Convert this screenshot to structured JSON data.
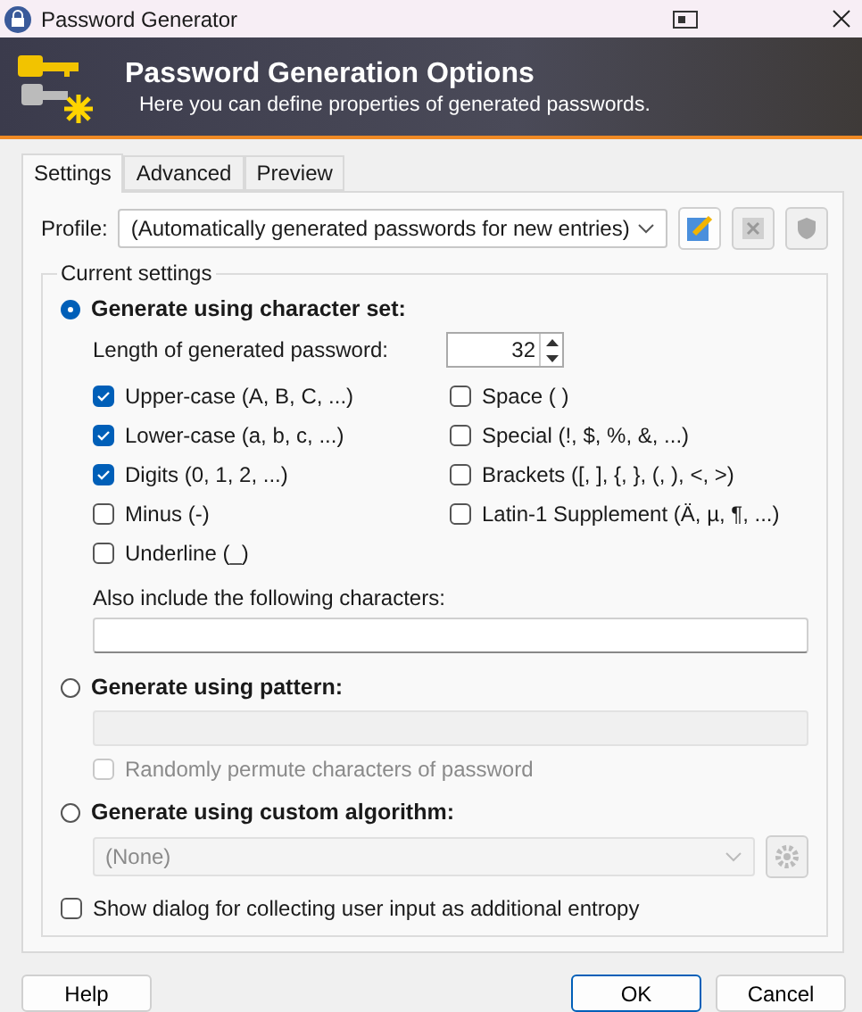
{
  "window": {
    "title": "Password Generator"
  },
  "banner": {
    "title": "Password Generation Options",
    "subtitle": "Here you can define properties of generated passwords."
  },
  "tabs": [
    {
      "label": "Settings",
      "selected": true
    },
    {
      "label": "Advanced",
      "selected": false
    },
    {
      "label": "Preview",
      "selected": false
    }
  ],
  "profile": {
    "label": "Profile:",
    "value": "(Automatically generated passwords for new entries)"
  },
  "current_settings": {
    "title": "Current settings",
    "charset_mode": {
      "label": "Generate using character set:",
      "selected": true,
      "length_label": "Length of generated password:",
      "length_value": "32",
      "options": [
        {
          "label": "Upper-case (A, B, C, ...)",
          "checked": true
        },
        {
          "label": "Lower-case (a, b, c, ...)",
          "checked": true
        },
        {
          "label": "Digits (0, 1, 2, ...)",
          "checked": true
        },
        {
          "label": "Minus (-)",
          "checked": false
        },
        {
          "label": "Underline (_)",
          "checked": false
        },
        {
          "label": "Space ( )",
          "checked": false
        },
        {
          "label": "Special (!, $, %, &, ...)",
          "checked": false
        },
        {
          "label": "Brackets ([, ], {, }, (, ), <, >)",
          "checked": false
        },
        {
          "label": "Latin-1 Supplement (Ä, µ, ¶, ...)",
          "checked": false
        }
      ],
      "also_label": "Also include the following characters:"
    },
    "pattern_mode": {
      "label": "Generate using pattern:",
      "selected": false,
      "permute": {
        "label": "Randomly permute characters of password",
        "checked": false,
        "disabled": true
      }
    },
    "custom_mode": {
      "label": "Generate using custom algorithm:",
      "selected": false,
      "algorithm": "(None)",
      "disabled": true
    },
    "entropy": {
      "label": "Show dialog for collecting user input as additional entropy",
      "checked": false
    }
  },
  "buttons": [
    {
      "label": "Help",
      "default": false
    },
    {
      "label": "OK",
      "default": true
    },
    {
      "label": "Cancel",
      "default": false
    }
  ]
}
